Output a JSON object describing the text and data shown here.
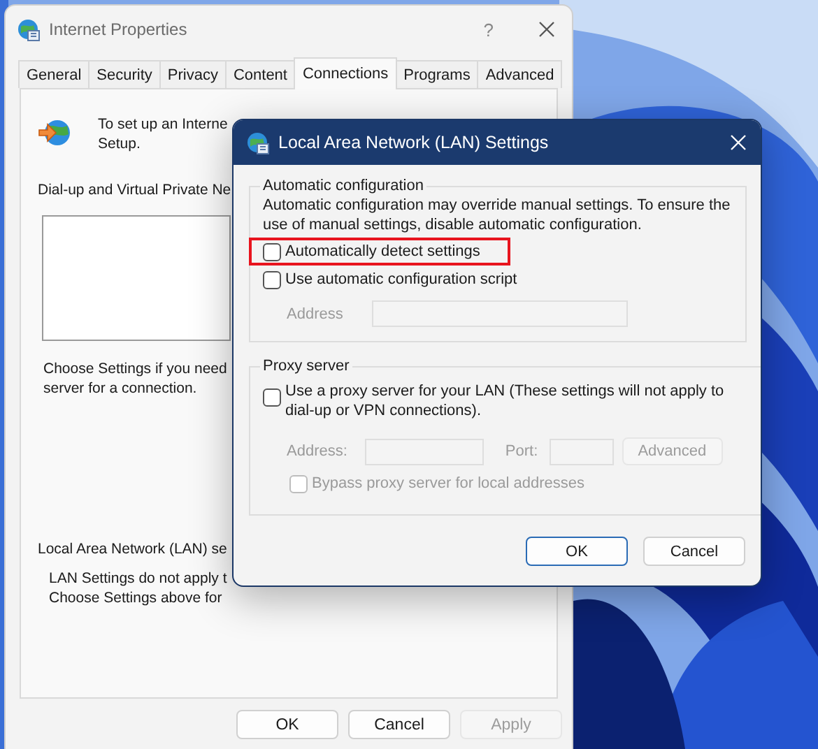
{
  "main_window": {
    "title": "Internet Properties",
    "help": "?",
    "tabs": [
      {
        "label": "General",
        "selected": false
      },
      {
        "label": "Security",
        "selected": false
      },
      {
        "label": "Privacy",
        "selected": false
      },
      {
        "label": "Content",
        "selected": false
      },
      {
        "label": "Connections",
        "selected": true
      },
      {
        "label": "Programs",
        "selected": false
      },
      {
        "label": "Advanced",
        "selected": false
      }
    ],
    "setup_text": [
      "To set up an Interne",
      "Setup."
    ],
    "vpn_label": "Dial-up and Virtual Private Ne",
    "vpn_note": [
      "Choose Settings if you need",
      "server for a connection."
    ],
    "lan_label": "Local Area Network (LAN) se",
    "lan_note": [
      "LAN Settings do not apply t",
      "Choose Settings above for"
    ],
    "buttons": [
      {
        "label": "OK",
        "disabled": false
      },
      {
        "label": "Cancel",
        "disabled": false
      },
      {
        "label": "Apply",
        "disabled": true
      }
    ]
  },
  "dialog": {
    "title": "Local Area Network (LAN) Settings",
    "automatic": {
      "title": "Automatic configuration",
      "description": "Automatic configuration may override manual settings.  To ensure the use of manual settings, disable automatic configuration.",
      "options": [
        {
          "label": "Automatically detect settings",
          "checked": false,
          "highlighted": true
        },
        {
          "label": "Use automatic configuration script",
          "checked": false,
          "highlighted": false
        }
      ],
      "address": {
        "label": "Address",
        "disabled": true
      }
    },
    "proxy": {
      "title": "Proxy server",
      "option": {
        "label": "Use a proxy server for your LAN (These settings will not apply to dial-up or VPN connections).",
        "checked": false
      },
      "address": {
        "label": "Address:",
        "disabled": true
      },
      "port": {
        "label": "Port:",
        "disabled": true
      },
      "advanced": {
        "label": "Advanced",
        "disabled": true
      },
      "bypass": {
        "label": "Bypass proxy server for local addresses",
        "checked": false,
        "disabled": true
      }
    },
    "buttons": [
      {
        "label": "OK",
        "default": true
      },
      {
        "label": "Cancel",
        "default": false
      }
    ]
  }
}
